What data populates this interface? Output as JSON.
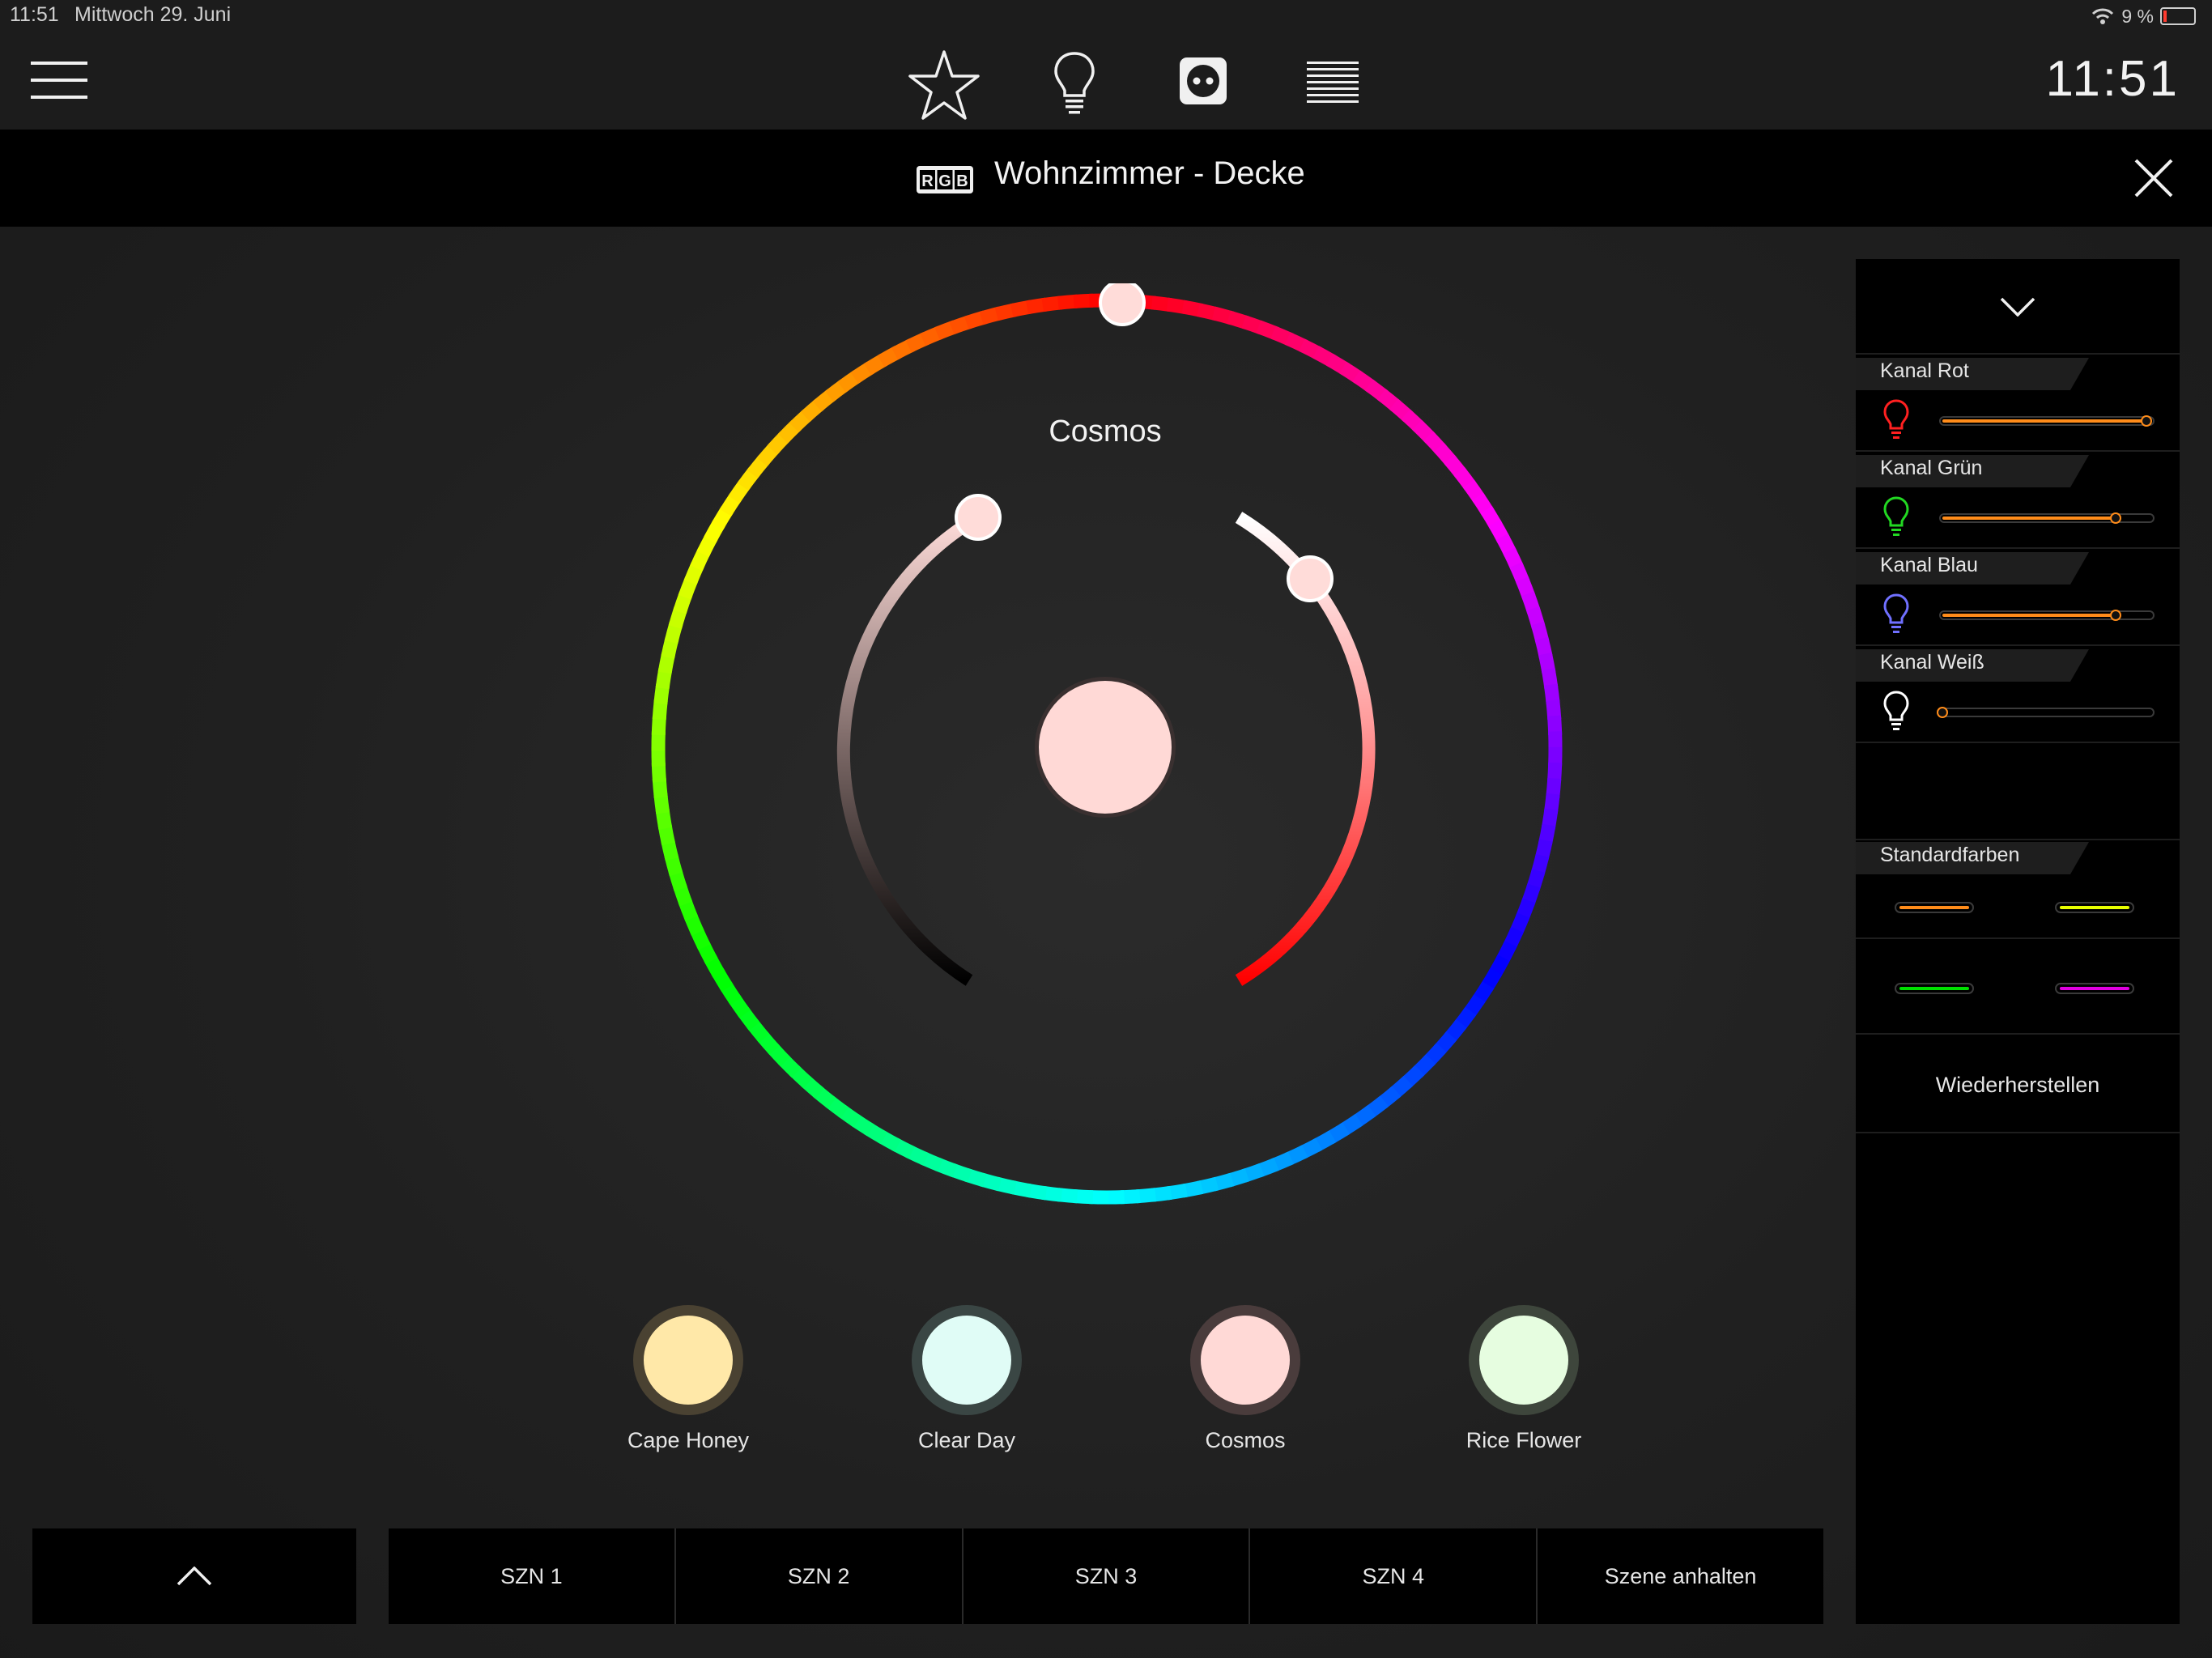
{
  "status_bar": {
    "time": "11:51",
    "date": "Mittwoch 29. Juni",
    "battery": "9 %"
  },
  "nav": {
    "icons": [
      "menu-icon",
      "star-icon",
      "lightbulb-icon",
      "power-socket-icon",
      "shutter-icon"
    ],
    "clock": "11:51"
  },
  "device": {
    "badge": "RGB",
    "title": "Wohnzimmer - Decke",
    "close_icon": "close-icon"
  },
  "color_picker": {
    "current_name": "Cosmos",
    "current_color": "#ffd9d6",
    "hue_wheel": "rainbow",
    "left_arc": "white-to-black",
    "right_arc": "white-to-red"
  },
  "presets": [
    {
      "label": "Cape Honey",
      "color": "#ffe8a8"
    },
    {
      "label": "Clear Day",
      "color": "#e0fcf6"
    },
    {
      "label": "Cosmos",
      "color": "#ffd9d6"
    },
    {
      "label": "Rice Flower",
      "color": "#e6fde0"
    }
  ],
  "scenes": {
    "collapse_icon": "chevron-up-icon",
    "buttons": [
      "SZN 1",
      "SZN 2",
      "SZN 3",
      "SZN 4",
      "Szene anhalten"
    ]
  },
  "side_panel": {
    "collapse_icon": "chevron-down-icon",
    "channels": [
      {
        "label": "Kanal Rot",
        "icon_color": "#ff2020",
        "value": 1.0
      },
      {
        "label": "Kanal Grün",
        "icon_color": "#22d822",
        "value": 0.85
      },
      {
        "label": "Kanal Blau",
        "icon_color": "#7070ff",
        "value": 0.85
      },
      {
        "label": "Kanal Weiß",
        "icon_color": "#ffffff",
        "value": 0.0
      }
    ],
    "standard_colors_label": "Standardfarben",
    "standard_colors": [
      "#ff8c1a",
      "#e8ff00",
      "#00e000",
      "#e000e0"
    ],
    "restore_label": "Wiederherstellen",
    "accent": "#ff8c1a"
  }
}
